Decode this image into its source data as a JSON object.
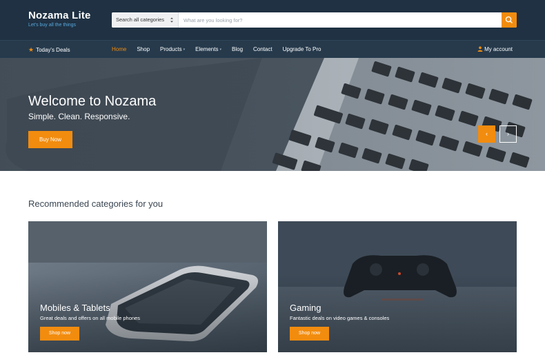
{
  "header": {
    "logo_title": "Nozama Lite",
    "logo_tagline": "Let's buy all the things",
    "search": {
      "category": "Search all categories",
      "placeholder": "What are you looking for?"
    }
  },
  "nav": {
    "deals_label": "Today's Deals",
    "items": [
      {
        "label": "Home",
        "active": true
      },
      {
        "label": "Shop"
      },
      {
        "label": "Products",
        "dropdown": true
      },
      {
        "label": "Elements",
        "dropdown": true
      },
      {
        "label": "Blog"
      },
      {
        "label": "Contact"
      },
      {
        "label": "Upgrade To Pro"
      }
    ],
    "account_label": "My account"
  },
  "hero": {
    "title": "Welcome to Nozama",
    "subtitle": "Simple. Clean. Responsive.",
    "button_label": "Buy Now",
    "prev_arrow": "‹",
    "next_arrow": "›"
  },
  "section": {
    "title": "Recommended categories for you",
    "cards": [
      {
        "title": "Mobiles & Tablets",
        "desc": "Great deals and offers on all mobile phones",
        "button_label": "Shop now"
      },
      {
        "title": "Gaming",
        "desc": "Fantastic deals on video games & consoles",
        "button_label": "Shop now"
      }
    ]
  },
  "colors": {
    "header_bg": "#1f3143",
    "nav_bg": "#263a4c",
    "accent": "#f28c0f",
    "tagline": "#5aa9dc"
  },
  "icons": [
    "search-icon",
    "star-icon",
    "user-icon",
    "chevron-left-icon",
    "chevron-right-icon",
    "select-caret-icon"
  ]
}
